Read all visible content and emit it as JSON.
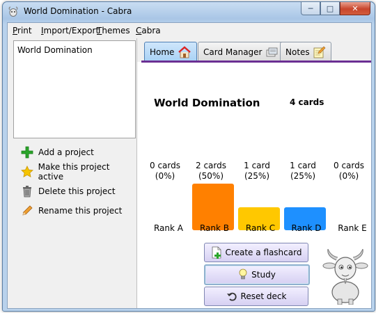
{
  "window": {
    "title": "World Domination - Cabra",
    "app_icon": "goat-icon",
    "controls": {
      "minimize": "─",
      "maximize": "□",
      "close": "✕"
    }
  },
  "menubar": {
    "items": [
      {
        "label": "Print",
        "underline": "P",
        "rest": "rint"
      },
      {
        "label": "Import/Export",
        "underline": "I",
        "rest": "mport/Export"
      },
      {
        "label": "Themes",
        "underline": "T",
        "rest": "hemes"
      },
      {
        "label": "Cabra",
        "underline": "C",
        "rest": "abra"
      }
    ]
  },
  "projects": {
    "items": [
      "World Domination"
    ]
  },
  "project_actions": [
    {
      "label": "Add a project",
      "icon": "plus-icon"
    },
    {
      "label": "Make this project active",
      "icon": "star-icon"
    },
    {
      "label": "Delete this project",
      "icon": "trash-icon"
    },
    {
      "label": "Rename this project",
      "icon": "pencil-icon"
    }
  ],
  "tabs": [
    {
      "label": "Home",
      "icon": "home-icon",
      "active": true
    },
    {
      "label": "Card Manager",
      "icon": "cards-icon",
      "active": false
    },
    {
      "label": "Notes",
      "icon": "notes-icon",
      "active": false
    }
  ],
  "home": {
    "project_title": "World Domination",
    "card_count": "4 cards"
  },
  "ranks": [
    {
      "name": "Rank A",
      "cards": "0 cards",
      "percent": "(0%)",
      "fraction": 0,
      "color": "#ff8000"
    },
    {
      "name": "Rank B",
      "cards": "2 cards",
      "percent": "(50%)",
      "fraction": 0.5,
      "color": "#ff8000"
    },
    {
      "name": "Rank C",
      "cards": "1 card",
      "percent": "(25%)",
      "fraction": 0.25,
      "color": "#ffc800"
    },
    {
      "name": "Rank D",
      "cards": "1 card",
      "percent": "(25%)",
      "fraction": 0.25,
      "color": "#1e90ff"
    },
    {
      "name": "Rank E",
      "cards": "0 cards",
      "percent": "(0%)",
      "fraction": 0,
      "color": "#7cc040"
    }
  ],
  "buttons": {
    "create": "Create a flashcard",
    "study": "Study",
    "reset": "Reset deck"
  },
  "mascot": "goat-mascot-icon",
  "colors": {
    "tab_underline": "#6b2f93",
    "button_face": "#d6d0f2"
  }
}
